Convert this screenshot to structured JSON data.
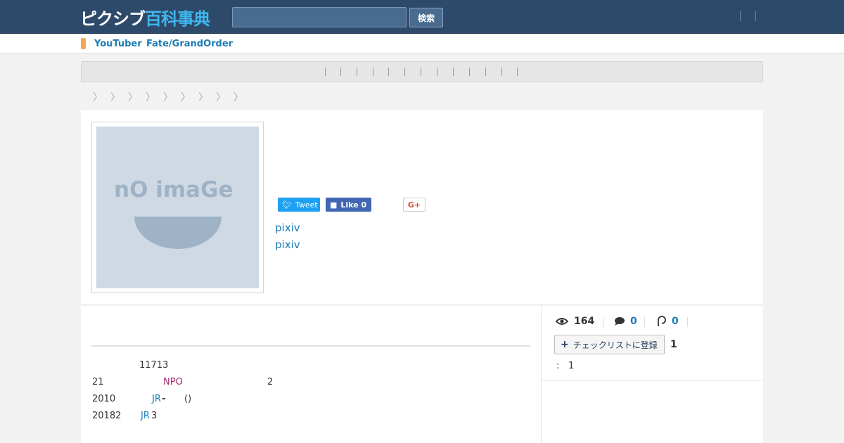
{
  "header": {
    "logo_part1": "ピクシブ",
    "logo_part2": "百科事典",
    "search_placeholder": "",
    "search_button": "検索"
  },
  "subbar": {
    "links": [
      "YouTuber",
      "Fate/GrandOrder"
    ]
  },
  "breadcrumb_separator": "〉",
  "article": {
    "image_text": "nO imaGe",
    "share": {
      "tweet": "Tweet",
      "like": "Like 0",
      "gplus": "G+"
    },
    "links": [
      "pixiv",
      "pixiv"
    ]
  },
  "body_lines": [
    {
      "a": "11713"
    },
    {
      "a": "21",
      "b": "NPO",
      "c": "2"
    },
    {
      "a": "2010",
      "b": "JR",
      "c": "-",
      "d": "()"
    },
    {
      "a": "20182",
      "b": "JR",
      "c": "3"
    }
  ],
  "stats": {
    "views": "164",
    "comments": "0",
    "tags": "0",
    "checklist_button": "チェックリストに登録",
    "checklist_count": "1",
    "rank_label": ":",
    "rank_value": "1"
  },
  "icons": {
    "views": "eye-icon",
    "comments": "comment-icon",
    "tags": "pin-icon",
    "plus": "plus-icon"
  }
}
